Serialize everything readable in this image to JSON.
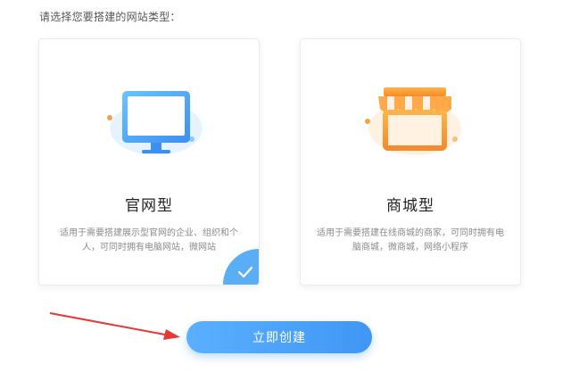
{
  "prompt": "请选择您要搭建的网站类型：",
  "cards": [
    {
      "title": "官网型",
      "desc": "适用于需要搭建展示型官网的企业、组织和个人，可同时拥有电脑网站，微网站",
      "selected": true,
      "icon": "monitor-icon"
    },
    {
      "title": "商城型",
      "desc": "适用于需要搭建在线商城的商家，可同时拥有电脑商城，微商城，网络小程序",
      "selected": false,
      "icon": "storefront-icon"
    }
  ],
  "create_button": {
    "label": "立即创建"
  },
  "colors": {
    "accent": "#4aa3f7",
    "arrow": "#e53935",
    "shop_orange": "#f7a23a"
  }
}
